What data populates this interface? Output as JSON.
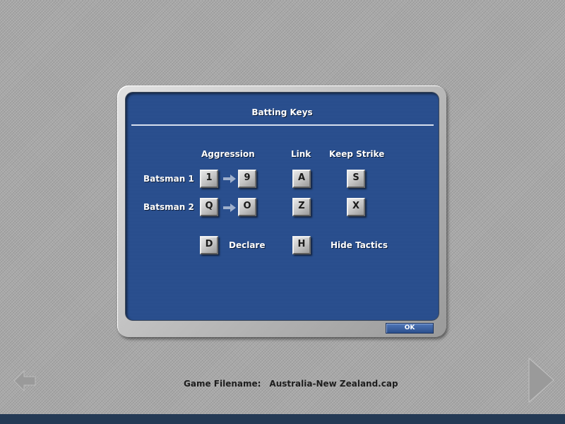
{
  "dialog": {
    "title": "Batting Keys",
    "headers": {
      "aggression": "Aggression",
      "link": "Link",
      "keep_strike": "Keep Strike"
    },
    "batsman1": {
      "label": "Batsman 1",
      "aggr_low": "1",
      "aggr_high": "9",
      "link": "A",
      "keep_strike": "S"
    },
    "batsman2": {
      "label": "Batsman 2",
      "aggr_low": "Q",
      "aggr_high": "O",
      "link": "Z",
      "keep_strike": "X"
    },
    "declare": {
      "key": "D",
      "label": "Declare"
    },
    "hide_tactics": {
      "key": "H",
      "label": "Hide Tactics"
    },
    "ok_label": "OK"
  },
  "status": {
    "filename_label": "Game Filename:",
    "filename_value": "Australia-New Zealand.cap"
  },
  "icons": {
    "arrow": "right-arrow-icon",
    "nav_back": "left-arrow-icon",
    "nav_next": "right-triangle-icon"
  },
  "colors": {
    "panel_blue": "#254b8b",
    "frame_grey": "#bdbdbd",
    "key_grey": "#c2c2c2",
    "text_white": "#ffffff"
  }
}
